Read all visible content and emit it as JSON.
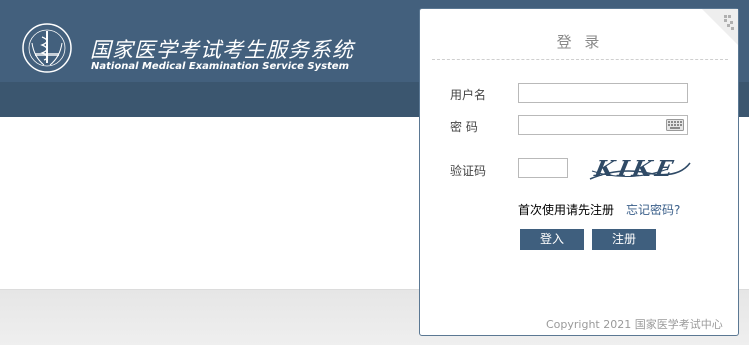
{
  "header": {
    "title_cn": "国家医学考试考生服务系统",
    "title_en": "National Medical Examination Service System"
  },
  "login": {
    "title": "登 录",
    "username_label": "用户名",
    "username_value": "",
    "password_label": "密 码",
    "password_value": "",
    "captcha_label": "验证码",
    "captcha_value": "",
    "captcha_text": "KIKE",
    "first_use_link": "首次使用请先注册",
    "forgot_link": "忘记密码?",
    "login_button": "登入",
    "register_button": "注册",
    "copyright": "Copyright 2021 国家医学考试中心"
  },
  "colors": {
    "header_bg": "#43607d",
    "button_bg": "#3f5f7e",
    "link": "#3a5f8a"
  },
  "icons": [
    "logo-emblem-icon",
    "qr-code-icon",
    "keyboard-icon"
  ]
}
